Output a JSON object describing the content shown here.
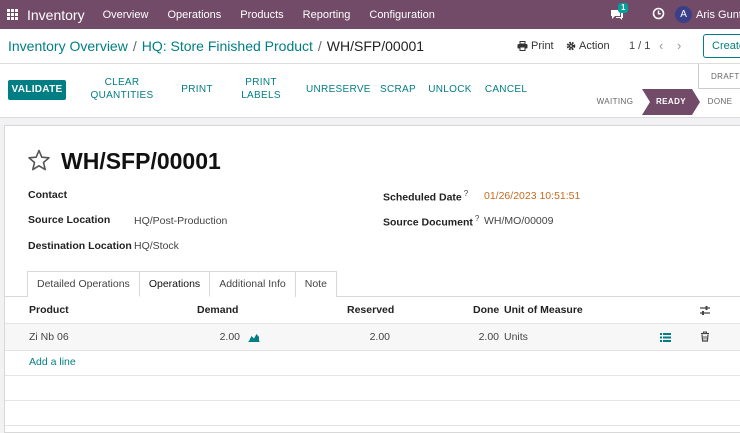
{
  "topnav": {
    "brand": "Inventory",
    "menu": [
      "Overview",
      "Operations",
      "Products",
      "Reporting",
      "Configuration"
    ],
    "chat_count": "1",
    "avatar_initial": "A",
    "user_name": "Aris Gunta"
  },
  "breadcrumb": {
    "items": [
      "Inventory Overview",
      "HQ: Store Finished Product"
    ],
    "current": "WH/SFP/00001"
  },
  "crumbbar": {
    "print_label": "Print",
    "action_label": "Action",
    "pager": "1 / 1",
    "prev": "‹",
    "next": "›",
    "create_label": "Create"
  },
  "actions": {
    "validate": "VALIDATE",
    "clear_quantities": "CLEAR QUANTITIES",
    "print": "PRINT",
    "print_labels": "PRINT LABELS",
    "unreserve": "UNRESERVE",
    "scrap": "SCRAP",
    "unlock": "UNLOCK",
    "cancel": "CANCEL"
  },
  "status": {
    "draft": "DRAFT",
    "waiting": "WAITING",
    "ready": "READY",
    "done": "DONE",
    "current": "READY"
  },
  "record": {
    "title": "WH/SFP/00001",
    "contact_label": "Contact",
    "contact_value": "",
    "source_location_label": "Source Location",
    "source_location_value": "HQ/Post-Production",
    "destination_location_label": "Destination Location",
    "destination_location_value": "HQ/Stock",
    "scheduled_date_label": "Scheduled Date",
    "scheduled_date_value": "01/26/2023 10:51:51",
    "source_document_label": "Source Document",
    "source_document_value": "WH/MO/00009",
    "help_mark": "?"
  },
  "tabs": [
    {
      "label": "Detailed Operations",
      "active": false
    },
    {
      "label": "Operations",
      "active": true
    },
    {
      "label": "Additional Info",
      "active": false
    },
    {
      "label": "Note",
      "active": false
    }
  ],
  "table": {
    "headers": {
      "product": "Product",
      "demand": "Demand",
      "reserved": "Reserved",
      "done": "Done",
      "uom": "Unit of Measure"
    },
    "rows": [
      {
        "product": "Zi Nb 06",
        "demand": "2.00",
        "reserved": "2.00",
        "done": "2.00",
        "uom": "Units"
      }
    ],
    "add_line": "Add a line"
  },
  "colors": {
    "brand": "#714b67",
    "accent": "#017e84",
    "date": "#c76a1f"
  },
  "icons": [
    "apps-grid-icon",
    "chat-icon",
    "clock-icon",
    "print-icon",
    "gear-icon",
    "star-icon",
    "forecast-chart-icon",
    "details-list-icon",
    "trash-icon",
    "column-settings-icon"
  ]
}
